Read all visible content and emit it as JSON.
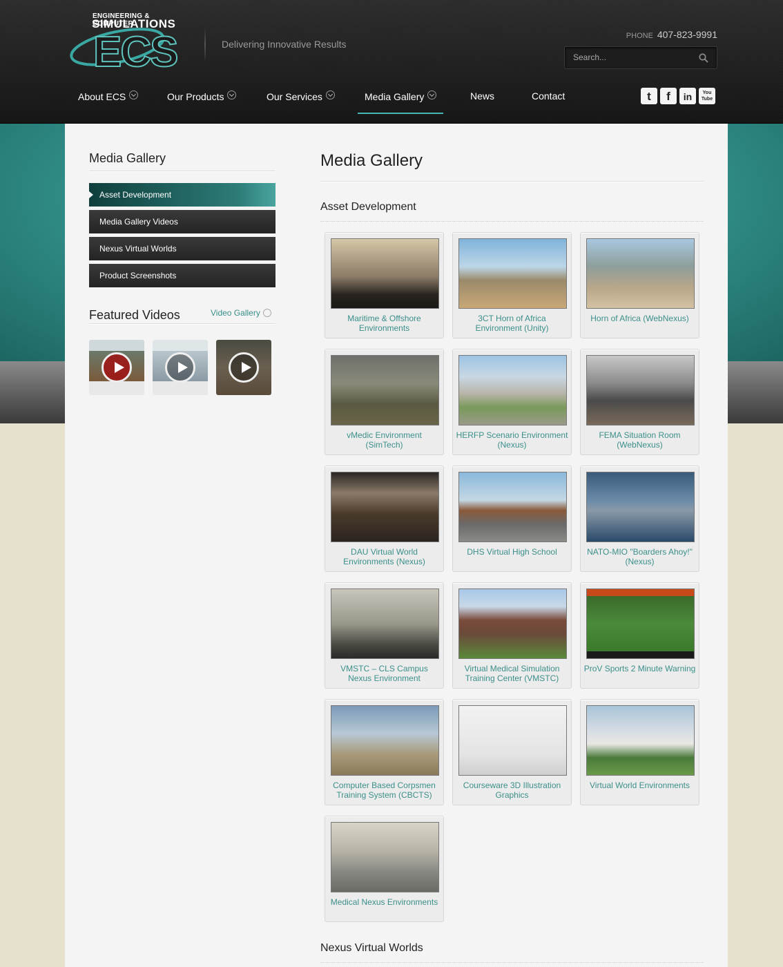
{
  "brand": {
    "logo_top": "ENGINEERING & COMPUTER",
    "logo_name": "SIMULATIONS",
    "tagline": "Delivering Innovative Results",
    "phone_label": "PHONE",
    "phone": "407-823-9991"
  },
  "search": {
    "placeholder": "Search..."
  },
  "nav": [
    "About ECS",
    "Our Products",
    "Our Services",
    "Media Gallery",
    "News",
    "Contact"
  ],
  "social": {
    "twitter": "t",
    "facebook": "f",
    "linkedin": "in",
    "youtube": "You Tube"
  },
  "sidebar": {
    "title": "Media Gallery",
    "items": [
      "Asset Development",
      "Media Gallery Videos",
      "Nexus Virtual Worlds",
      "Product Screenshots"
    ],
    "featured_title": "Featured Videos",
    "video_gallery_link": "Video Gallery"
  },
  "main": {
    "title": "Media Gallery",
    "section1": "Asset Development",
    "section2": "Nexus Virtual Worlds",
    "cards": [
      "Maritime & Offshore Environments",
      "3CT Horn of Africa Environment (Unity)",
      "Horn of Africa (WebNexus)",
      "vMedic Environment (SimTech)",
      "HERFP Scenario Environment (Nexus)",
      "FEMA Situation Room (WebNexus)",
      "DAU Virtual World Environments (Nexus)",
      "DHS Virtual High School",
      "NATO-MIO \"Boarders Ahoy!\" (Nexus)",
      "VMSTC – CLS Campus Nexus Environment",
      "Virtual Medical Simulation Training Center (VMSTC)",
      "ProV Sports 2 Minute Warning",
      "Computer Based Corpsmen Training System (CBCTS)",
      "Courseware 3D Illustration Graphics",
      "Virtual World Environments",
      "Medical Nexus Environments"
    ]
  }
}
